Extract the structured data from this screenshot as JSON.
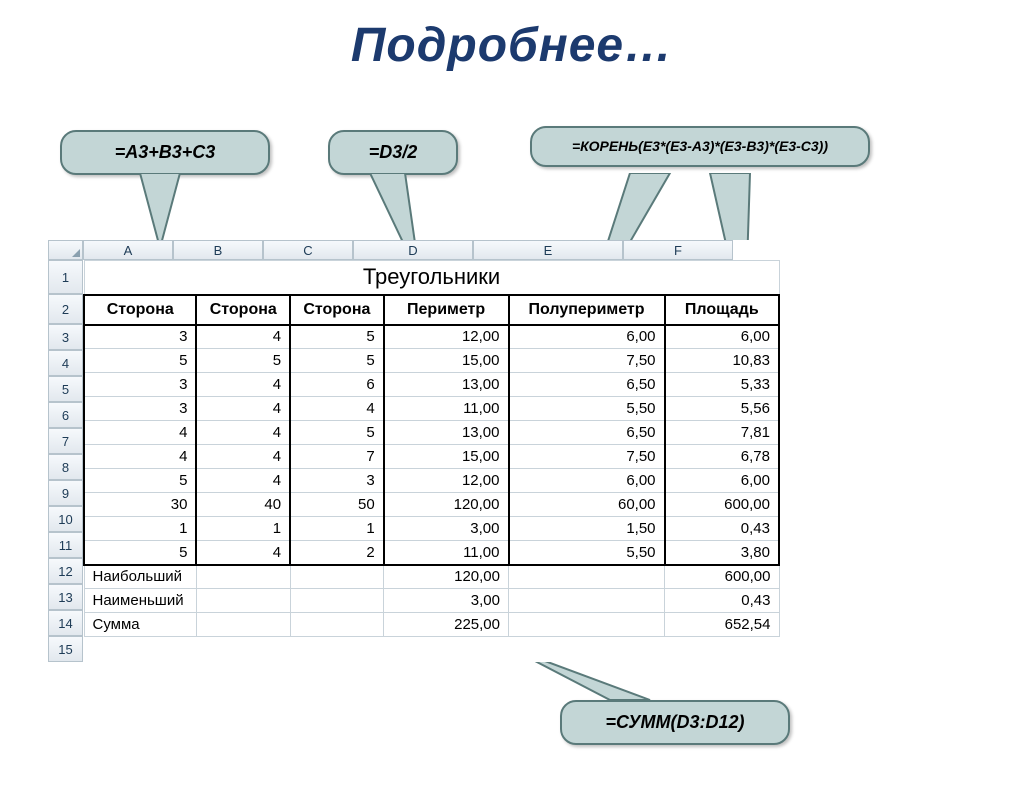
{
  "title": "Подробнее…",
  "callouts": {
    "c1": "=A3+B3+C3",
    "c2": "=D3/2",
    "c3": "=КОРЕНЬ(E3*(E3-A3)*(E3-B3)*(E3-C3))",
    "c4": "=СУММ(D3:D12)"
  },
  "cols": {
    "A": "A",
    "B": "B",
    "C": "C",
    "D": "D",
    "E": "E",
    "F": "F"
  },
  "rownums": [
    "1",
    "2",
    "3",
    "4",
    "5",
    "6",
    "7",
    "8",
    "9",
    "10",
    "11",
    "12",
    "13",
    "14",
    "15"
  ],
  "sheet": {
    "merged_title": "Треугольники",
    "headers": {
      "a": "Сторона",
      "b": "Сторона",
      "c": "Сторона",
      "d": "Периметр",
      "e": "Полупериметр",
      "f": "Площадь"
    },
    "rows": [
      {
        "a": "3",
        "b": "4",
        "c": "5",
        "d": "12,00",
        "e": "6,00",
        "f": "6,00"
      },
      {
        "a": "5",
        "b": "5",
        "c": "5",
        "d": "15,00",
        "e": "7,50",
        "f": "10,83"
      },
      {
        "a": "3",
        "b": "4",
        "c": "6",
        "d": "13,00",
        "e": "6,50",
        "f": "5,33"
      },
      {
        "a": "3",
        "b": "4",
        "c": "4",
        "d": "11,00",
        "e": "5,50",
        "f": "5,56"
      },
      {
        "a": "4",
        "b": "4",
        "c": "5",
        "d": "13,00",
        "e": "6,50",
        "f": "7,81"
      },
      {
        "a": "4",
        "b": "4",
        "c": "7",
        "d": "15,00",
        "e": "7,50",
        "f": "6,78"
      },
      {
        "a": "5",
        "b": "4",
        "c": "3",
        "d": "12,00",
        "e": "6,00",
        "f": "6,00"
      },
      {
        "a": "30",
        "b": "40",
        "c": "50",
        "d": "120,00",
        "e": "60,00",
        "f": "600,00"
      },
      {
        "a": "1",
        "b": "1",
        "c": "1",
        "d": "3,00",
        "e": "1,50",
        "f": "0,43"
      },
      {
        "a": "5",
        "b": "4",
        "c": "2",
        "d": "11,00",
        "e": "5,50",
        "f": "3,80"
      }
    ],
    "summary": [
      {
        "label": "Наибольший",
        "d": "120,00",
        "f": "600,00"
      },
      {
        "label": "Наименьший",
        "d": "3,00",
        "f": "0,43"
      },
      {
        "label": "Сумма",
        "d": "225,00",
        "f": "652,54"
      }
    ]
  },
  "colwidths": {
    "A": 90,
    "B": 90,
    "C": 90,
    "D": 120,
    "E": 150,
    "F": 110
  }
}
